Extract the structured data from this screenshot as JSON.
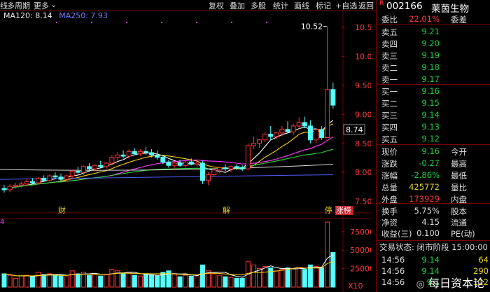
{
  "toolbar": {
    "left": [
      "线",
      "多周期",
      "更多"
    ],
    "right": [
      "复权",
      "叠加",
      "多股",
      "统计",
      "画线",
      "标记",
      "+自选",
      "返回"
    ],
    "return_icon": "back-arrow-icon"
  },
  "ma_legend": [
    {
      "text": "MA120: 8.14",
      "color": "#e8e8e8"
    },
    {
      "text": "MA250: 7.93",
      "color": "#9b4dff"
    }
  ],
  "chart": {
    "price_ticks": [
      "10.50",
      "10.00",
      "9.50",
      "9.00",
      "8.50",
      "8.00",
      "7.50"
    ],
    "price_ticks_values": [
      10.5,
      10.0,
      9.5,
      9.0,
      8.5,
      8.0,
      7.5
    ],
    "current_price_tag": "8.74",
    "high_marker": "10.52",
    "events": [
      {
        "text": "财",
        "index": 10
      },
      {
        "text": "解",
        "index": 39
      },
      {
        "text": "停",
        "index": 57
      },
      {
        "text": "涨榜",
        "index": 59
      }
    ],
    "volume_ticks": [
      "75000",
      "50000",
      "25000"
    ],
    "volume_ticks_values": [
      75000,
      50000,
      25000
    ],
    "volume_unit": "X10",
    "volume_label_left": "4",
    "colors": {
      "up": "#ff3333",
      "down": "#54ffff",
      "ma5": "#ffffff",
      "ma10": "#ffd500",
      "ma20": "#ff3cff",
      "ma60": "#2dd43b",
      "ma120": "#d8d8d8",
      "ma250": "#4f5cff",
      "grid": "#6a0000"
    }
  },
  "stock": {
    "code": "002166",
    "name": "莱茵生物",
    "flag": "R"
  },
  "commission": {
    "ratio_label": "委比",
    "ratio": "22.01%",
    "diff_label": "委差"
  },
  "asks": [
    {
      "label": "卖五",
      "price": "9.21"
    },
    {
      "label": "卖四",
      "price": "9.20"
    },
    {
      "label": "卖三",
      "price": "9.19"
    },
    {
      "label": "卖二",
      "price": "9.18"
    },
    {
      "label": "卖一",
      "price": "9.17"
    }
  ],
  "bids": [
    {
      "label": "买一",
      "price": "9.16"
    },
    {
      "label": "买二",
      "price": "9.15"
    },
    {
      "label": "买三",
      "price": "9.14"
    },
    {
      "label": "买四",
      "price": "9.13"
    },
    {
      "label": "买五",
      "price": "9.12"
    }
  ],
  "quote": [
    {
      "label": "现价",
      "value": "9.16",
      "cls": "green",
      "extra": "今开"
    },
    {
      "label": "涨跌",
      "value": "-0.27",
      "cls": "green",
      "extra": "最高"
    },
    {
      "label": "涨幅",
      "value": "-2.86%",
      "cls": "green",
      "extra": "最低"
    },
    {
      "label": "总量",
      "value": "425772",
      "cls": "yellow",
      "extra": "量比"
    },
    {
      "label": "外盘",
      "value": "173929",
      "cls": "red",
      "extra": "内盘"
    }
  ],
  "fundamentals": [
    {
      "label": "换手",
      "value": "5.75%",
      "extra": "股本"
    },
    {
      "label": "净资",
      "value": "4.15",
      "extra": "流通"
    },
    {
      "label": "收益(三)",
      "value": "0.100",
      "extra": "PE(动)"
    }
  ],
  "trading_status": "交易状态: 闭市阶段 15:00:00",
  "ticks": [
    {
      "time": "14:56",
      "price": "9.14",
      "vol": "64"
    },
    {
      "time": "14:56",
      "price": "9.14",
      "vol": "290"
    },
    {
      "time": "14:56",
      "price": "9.1",
      "vol": "112"
    }
  ],
  "watermark": "每日资本论"
}
